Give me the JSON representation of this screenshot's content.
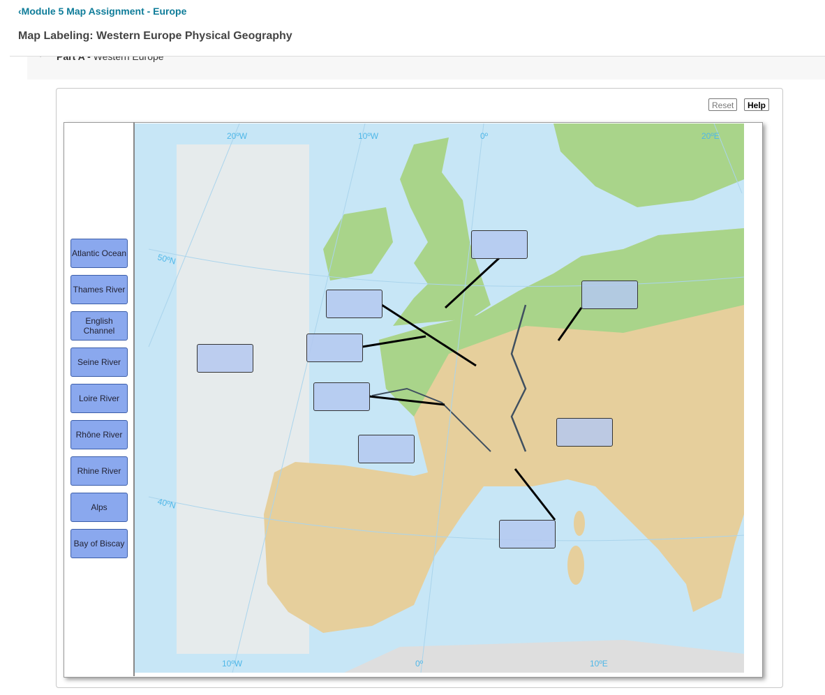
{
  "header": {
    "back_link": "Module 5 Map Assignment - Europe",
    "title": "Map Labeling: Western Europe Physical Geography"
  },
  "section": {
    "part_bold": "Part A - ",
    "part_text": "Western Europe"
  },
  "toolbar": {
    "reset": "Reset",
    "help": "Help"
  },
  "labels": [
    "Atlantic Ocean",
    "Thames River",
    "English Channel",
    "Seine River",
    "Loire River",
    "Rhône River",
    "Rhine River",
    "Alps",
    "Bay of Biscay"
  ],
  "map": {
    "top_graticule": [
      "20ºW",
      "10ºW",
      "0º",
      "20ºE"
    ],
    "left_graticule": [
      "50ºN",
      "40ºN"
    ],
    "bottom_graticule": [
      "10ºW",
      "0º",
      "10ºE"
    ],
    "colors": {
      "sea": "#c7e6f6",
      "land": "#e6cf9c",
      "lowland": "#a9d48a",
      "label_bg": "#8aa8ee"
    }
  }
}
